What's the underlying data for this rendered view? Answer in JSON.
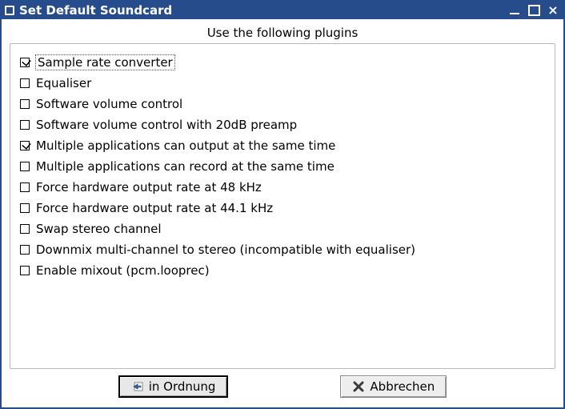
{
  "window": {
    "title": "Set Default Soundcard"
  },
  "heading": "Use the following plugins",
  "plugins": [
    {
      "label": "Sample rate converter",
      "checked": true,
      "focused": true
    },
    {
      "label": "Equaliser",
      "checked": false,
      "focused": false
    },
    {
      "label": "Software volume control",
      "checked": false,
      "focused": false
    },
    {
      "label": "Software volume control with 20dB preamp",
      "checked": false,
      "focused": false
    },
    {
      "label": "Multiple applications can output at the same time",
      "checked": true,
      "focused": false
    },
    {
      "label": "Multiple applications can record at the same time",
      "checked": false,
      "focused": false
    },
    {
      "label": "Force hardware output rate at 48 kHz",
      "checked": false,
      "focused": false
    },
    {
      "label": "Force hardware output rate at 44.1 kHz",
      "checked": false,
      "focused": false
    },
    {
      "label": "Swap stereo channel",
      "checked": false,
      "focused": false
    },
    {
      "label": "Downmix multi-channel to stereo (incompatible with equaliser)",
      "checked": false,
      "focused": false
    },
    {
      "label": "Enable mixout (pcm.looprec)",
      "checked": false,
      "focused": false
    }
  ],
  "buttons": {
    "ok": "in Ordnung",
    "cancel": "Abbrechen"
  }
}
